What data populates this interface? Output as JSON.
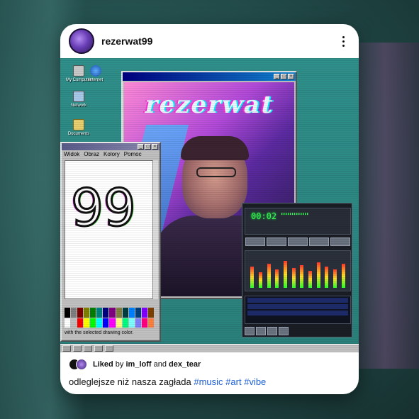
{
  "post": {
    "username": "rezerwat99",
    "likes": {
      "prefix": "Liked",
      "by_word": "by",
      "user1": "im_loff",
      "and_word": "and",
      "user2": "dex_tear"
    },
    "caption": {
      "text": "odleglejsze niż nasza zagłada",
      "hashtags": [
        "#music",
        "#art",
        "#vibe"
      ]
    }
  },
  "image": {
    "album_title": "rezerwat",
    "paint": {
      "menu": [
        "Widok",
        "Obraz",
        "Kolory",
        "Pomoc"
      ],
      "drawing": "99",
      "status": "with the selected drawing color."
    },
    "winamp": {
      "time": "00:02"
    }
  },
  "colors": {
    "hashtag": "#1f5fd6",
    "desktop": "#2f8f8a",
    "titlebar": "#000080",
    "winamp_display": "#3aff5a"
  },
  "icons": [
    "more-options-icon",
    "avatar",
    "like-avatars"
  ]
}
